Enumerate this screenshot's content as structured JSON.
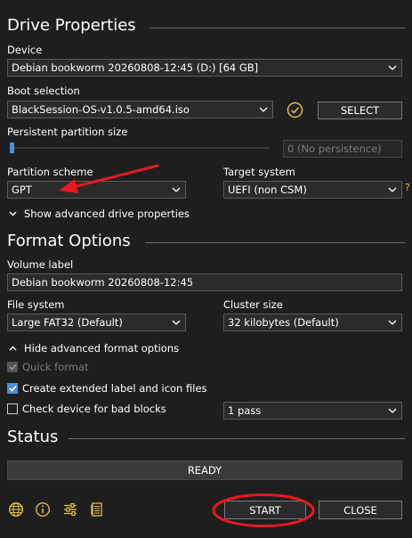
{
  "drive_properties": {
    "title": "Drive Properties",
    "device_label": "Device",
    "device_value": "Debian bookworm 20260808-12:45 (D:) [64 GB]",
    "boot_selection_label": "Boot selection",
    "boot_selection_value": "BlackSession-OS-v1.0.5-amd64.iso",
    "select_button": "SELECT",
    "persistent_label": "Persistent partition size",
    "persistent_value": "0 (No persistence)",
    "partition_scheme_label": "Partition scheme",
    "partition_scheme_value": "GPT",
    "target_system_label": "Target system",
    "target_system_value": "UEFI (non CSM)",
    "target_help": "?",
    "advanced_toggle": "Show advanced drive properties"
  },
  "format_options": {
    "title": "Format Options",
    "volume_label_label": "Volume label",
    "volume_label_value": "Debian bookworm 20260808-12:45",
    "file_system_label": "File system",
    "file_system_value": "Large FAT32 (Default)",
    "cluster_size_label": "Cluster size",
    "cluster_size_value": "32 kilobytes (Default)",
    "advanced_toggle": "Hide advanced format options",
    "quick_format": "Quick format",
    "extended_label": "Create extended label and icon files",
    "bad_blocks": "Check device for bad blocks",
    "passes_value": "1 pass"
  },
  "status": {
    "title": "Status",
    "state": "READY"
  },
  "footer": {
    "start": "START",
    "close": "CLOSE"
  },
  "colors": {
    "background": "#1e1e1e",
    "accent": "#4a90d9",
    "annotation_red": "#e8191e",
    "check_yellow": "#e0c040"
  }
}
